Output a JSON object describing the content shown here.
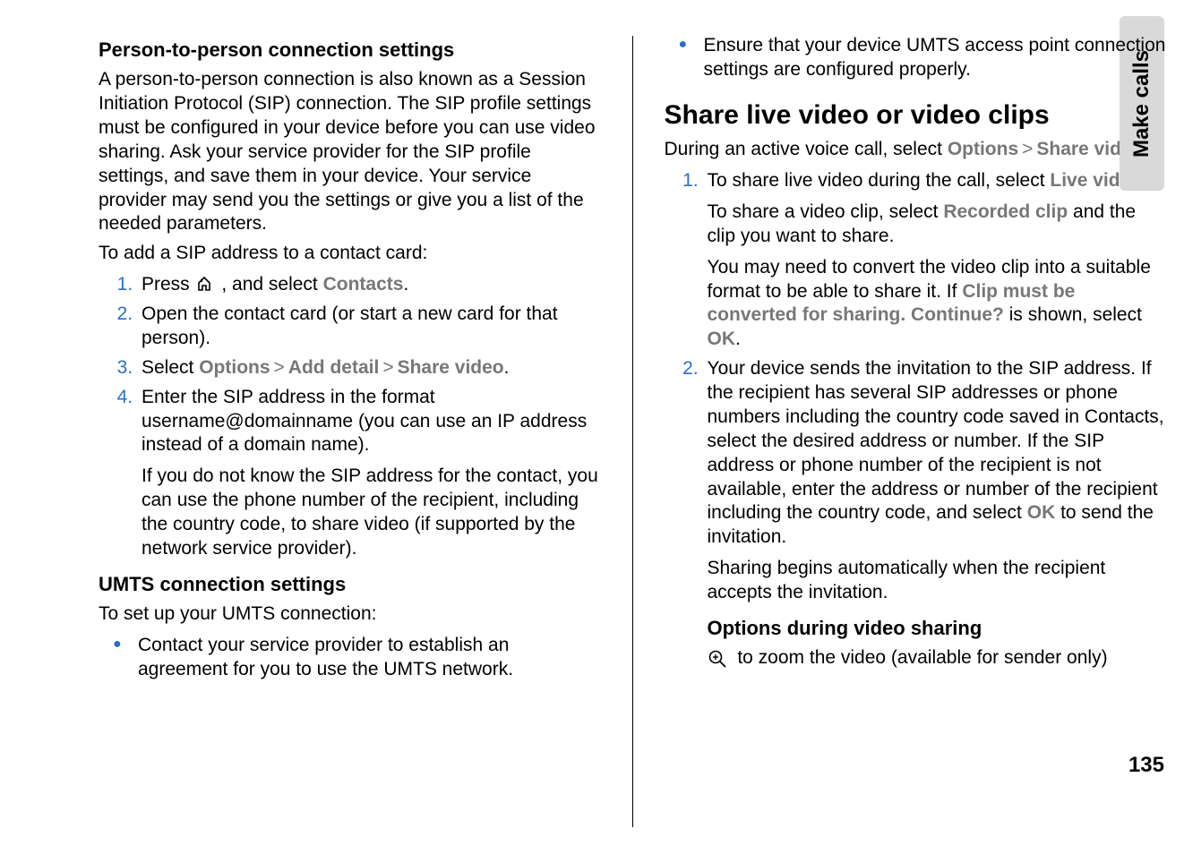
{
  "sideTab": "Make calls",
  "pageNumber": "135",
  "left": {
    "h1": "Person-to-person connection settings",
    "p1": "A person-to-person connection is also known as a Session Initiation Protocol (SIP) connection. The SIP profile settings must be configured in your device before you can use video sharing. Ask your service provider for the SIP profile settings, and save them in your device. Your service provider may send you the settings or give you a list of the needed parameters.",
    "p2": "To add a SIP address to a contact card:",
    "step1a": "Press ",
    "step1b": " , and select ",
    "step1_ui": "Contacts",
    "step1c": ".",
    "step2": "Open the contact card (or start a new card for that person).",
    "step3a": "Select ",
    "step3_ui1": "Options",
    "step3_ui2": "Add detail",
    "step3_ui3": "Share video",
    "step3b": ".",
    "step4a": "Enter the SIP address in the format username@domainname (you can use an IP address instead of a domain name).",
    "step4b": "If you do not know the SIP address for the contact, you can use the phone number of the recipient, including the country code, to share video (if supported by the network service provider).",
    "h2": "UMTS connection settings",
    "p3": "To set up your UMTS connection:",
    "bul1": "Contact your service provider to establish an agreement for you to use the UMTS network."
  },
  "right": {
    "bul1": "Ensure that your device UMTS access point connection settings are configured properly.",
    "h1": "Share live video or video clips",
    "p1a": "During an active voice call, select ",
    "p1_ui1": "Options",
    "p1_ui2": "Share video",
    "p1b": ":",
    "step1a": "To share live video during the call, select ",
    "step1_ui1": "Live video",
    "step1b": ".",
    "step1c": "To share a video clip, select ",
    "step1_ui2": "Recorded clip",
    "step1d": " and the clip you want to share.",
    "step1e": "You may need to convert the video clip into a suitable format to be able to share it. If ",
    "step1_ui3": "Clip must be converted for sharing. Continue?",
    "step1f": " is shown, select ",
    "step1_ui4": "OK",
    "step1g": ".",
    "step2a": "Your device sends the invitation to the SIP address. If the recipient has several SIP addresses or phone numbers including the country code saved in Contacts, select the desired address or number. If the SIP address or phone number of the recipient is not available, enter the address or number of the recipient including the country code, and select ",
    "step2_ui1": "OK",
    "step2b": " to send the invitation.",
    "step2c": "Sharing begins automatically when the recipient accepts the invitation.",
    "h2": "Options during video sharing",
    "opt1": " to zoom the video (available for sender only)"
  }
}
